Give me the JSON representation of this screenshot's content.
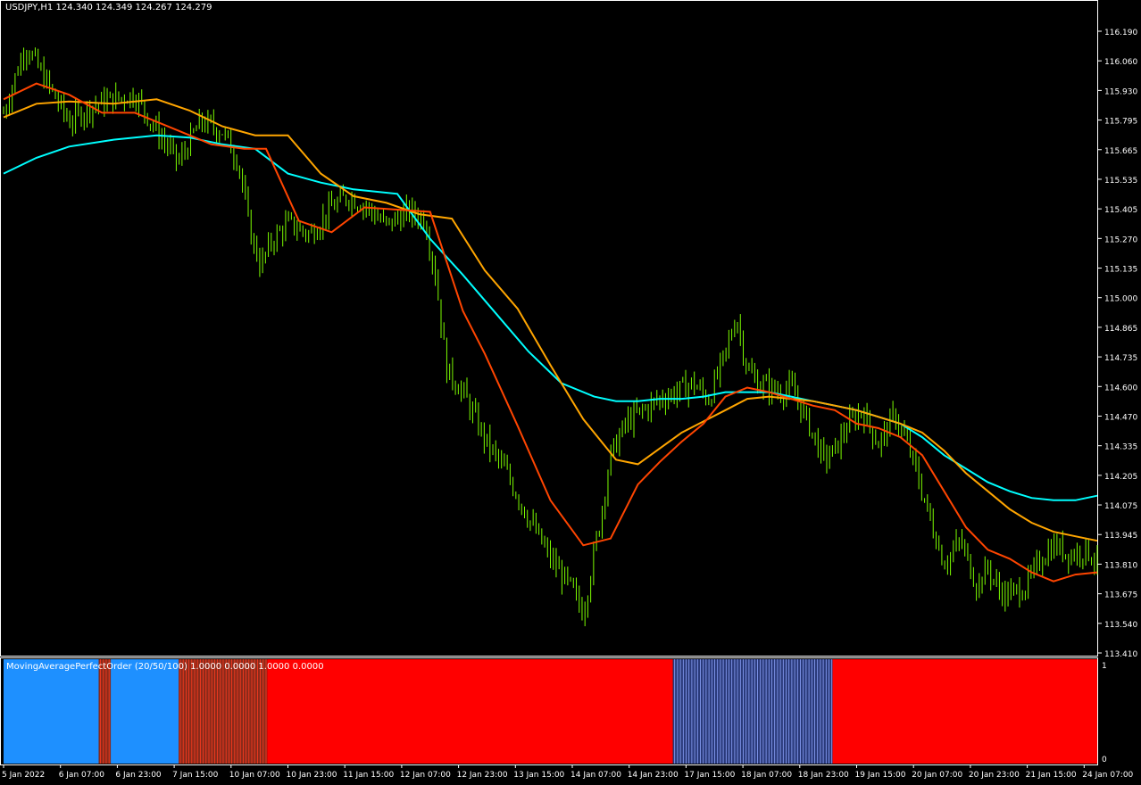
{
  "header": {
    "symbol": "USDJPY,H1",
    "quotes": "124.340 124.349 124.267 124.279"
  },
  "indicator": {
    "label": "MovingAveragePerfectOrder (20/50/100) 1.0000 0.0000 1.0000 0.0000",
    "scale_top": "1",
    "scale_bottom": "0",
    "segments": [
      {
        "from": 0,
        "to": 0.087,
        "state": "bullish",
        "color": "#1e90ff"
      },
      {
        "from": 0.087,
        "to": 0.098,
        "state": "mixed",
        "color": "#8b2a1a"
      },
      {
        "from": 0.098,
        "to": 0.16,
        "state": "bullish",
        "color": "#1e90ff"
      },
      {
        "from": 0.16,
        "to": 0.241,
        "state": "mixed",
        "color": "#8b2a1a"
      },
      {
        "from": 0.241,
        "to": 0.612,
        "state": "bearish",
        "color": "#ff0000"
      },
      {
        "from": 0.612,
        "to": 0.758,
        "state": "mixed",
        "color": "#2a3a7a"
      },
      {
        "from": 0.758,
        "to": 1,
        "state": "bearish",
        "color": "#ff0000"
      }
    ]
  },
  "chart_data": {
    "type": "line",
    "title": "USDJPY,H1",
    "y_ticks": [
      "116.190",
      "116.060",
      "115.930",
      "115.795",
      "115.665",
      "115.535",
      "115.405",
      "115.270",
      "115.135",
      "115.000",
      "114.865",
      "114.735",
      "114.600",
      "114.470",
      "114.335",
      "114.205",
      "114.075",
      "113.945",
      "113.810",
      "113.675",
      "113.540",
      "113.410"
    ],
    "ylim": [
      113.41,
      116.19
    ],
    "x_ticks": [
      "5 Jan 2022",
      "6 Jan 07:00",
      "6 Jan 23:00",
      "7 Jan 15:00",
      "10 Jan 07:00",
      "10 Jan 23:00",
      "11 Jan 15:00",
      "12 Jan 07:00",
      "12 Jan 23:00",
      "13 Jan 15:00",
      "14 Jan 07:00",
      "14 Jan 23:00",
      "17 Jan 15:00",
      "18 Jan 07:00",
      "18 Jan 23:00",
      "19 Jan 15:00",
      "20 Jan 07:00",
      "20 Jan 23:00",
      "21 Jan 15:00",
      "24 Jan 07:00"
    ],
    "x_tick_pos": [
      0,
      0.052,
      0.104,
      0.156,
      0.208,
      0.26,
      0.312,
      0.364,
      0.416,
      0.468,
      0.52,
      0.572,
      0.624,
      0.676,
      0.728,
      0.78,
      0.832,
      0.884,
      0.936,
      0.988
    ],
    "colors": {
      "price": "#7CFC00",
      "ma20": "#ff4500",
      "ma50": "#ffa500",
      "ma100": "#00ffff",
      "bullish": "#1e90ff",
      "bearish": "#ff0000"
    },
    "price": {
      "t": [
        0,
        0.02,
        0.04,
        0.06,
        0.08,
        0.1,
        0.12,
        0.14,
        0.16,
        0.18,
        0.2,
        0.215,
        0.225,
        0.235,
        0.245,
        0.26,
        0.28,
        0.3,
        0.315,
        0.33,
        0.35,
        0.37,
        0.385,
        0.395,
        0.405,
        0.42,
        0.44,
        0.46,
        0.48,
        0.5,
        0.52,
        0.53,
        0.545,
        0.555,
        0.57,
        0.585,
        0.6,
        0.615,
        0.63,
        0.645,
        0.66,
        0.67,
        0.68,
        0.69,
        0.7,
        0.71,
        0.72,
        0.735,
        0.75,
        0.76,
        0.77,
        0.785,
        0.8,
        0.815,
        0.83,
        0.845,
        0.86,
        0.875,
        0.89,
        0.9,
        0.91,
        0.92,
        0.935,
        0.95,
        0.96,
        0.975,
        0.99,
        1
      ],
      "y": [
        115.82,
        116.12,
        115.95,
        115.78,
        115.85,
        115.88,
        115.9,
        115.74,
        115.6,
        115.78,
        115.74,
        115.6,
        115.3,
        115.14,
        115.25,
        115.33,
        115.28,
        115.4,
        115.45,
        115.41,
        115.32,
        115.38,
        115.35,
        115.1,
        114.68,
        114.58,
        114.37,
        114.22,
        114.02,
        113.84,
        113.7,
        113.6,
        114.0,
        114.3,
        114.45,
        114.5,
        114.55,
        114.58,
        114.62,
        114.55,
        114.75,
        114.92,
        114.68,
        114.62,
        114.6,
        114.58,
        114.6,
        114.45,
        114.28,
        114.32,
        114.42,
        114.5,
        114.35,
        114.48,
        114.3,
        114.05,
        113.82,
        113.92,
        113.72,
        113.8,
        113.7,
        113.68,
        113.72,
        113.85,
        113.9,
        113.86,
        113.88,
        113.82
      ]
    },
    "ma20": {
      "t": [
        0,
        0.03,
        0.06,
        0.09,
        0.12,
        0.16,
        0.19,
        0.22,
        0.24,
        0.27,
        0.3,
        0.33,
        0.36,
        0.39,
        0.42,
        0.44,
        0.47,
        0.5,
        0.53,
        0.555,
        0.58,
        0.6,
        0.62,
        0.64,
        0.66,
        0.68,
        0.7,
        0.72,
        0.74,
        0.76,
        0.78,
        0.8,
        0.82,
        0.84,
        0.86,
        0.88,
        0.9,
        0.92,
        0.94,
        0.96,
        0.98,
        1
      ],
      "y": [
        115.88,
        115.95,
        115.9,
        115.82,
        115.82,
        115.74,
        115.68,
        115.66,
        115.66,
        115.34,
        115.29,
        115.4,
        115.39,
        115.38,
        114.94,
        114.75,
        114.43,
        114.1,
        113.9,
        113.93,
        114.17,
        114.27,
        114.36,
        114.44,
        114.56,
        114.6,
        114.58,
        114.55,
        114.52,
        114.5,
        114.44,
        114.42,
        114.38,
        114.3,
        114.14,
        113.98,
        113.88,
        113.84,
        113.78,
        113.74,
        113.77,
        113.78
      ]
    },
    "ma50": {
      "t": [
        0,
        0.03,
        0.06,
        0.1,
        0.14,
        0.17,
        0.2,
        0.23,
        0.26,
        0.29,
        0.32,
        0.35,
        0.38,
        0.41,
        0.44,
        0.47,
        0.5,
        0.53,
        0.56,
        0.58,
        0.6,
        0.62,
        0.64,
        0.66,
        0.68,
        0.7,
        0.72,
        0.74,
        0.76,
        0.78,
        0.8,
        0.82,
        0.84,
        0.86,
        0.88,
        0.9,
        0.92,
        0.94,
        0.96,
        0.98,
        1
      ],
      "y": [
        115.8,
        115.86,
        115.87,
        115.86,
        115.88,
        115.83,
        115.76,
        115.72,
        115.72,
        115.55,
        115.45,
        115.42,
        115.37,
        115.35,
        115.12,
        114.95,
        114.7,
        114.46,
        114.28,
        114.26,
        114.33,
        114.4,
        114.45,
        114.5,
        114.55,
        114.56,
        114.55,
        114.54,
        114.52,
        114.5,
        114.47,
        114.44,
        114.4,
        114.32,
        114.22,
        114.14,
        114.06,
        114.0,
        113.96,
        113.94,
        113.92
      ]
    },
    "ma100": {
      "t": [
        0,
        0.03,
        0.06,
        0.1,
        0.14,
        0.17,
        0.2,
        0.23,
        0.26,
        0.29,
        0.32,
        0.36,
        0.39,
        0.42,
        0.45,
        0.48,
        0.51,
        0.54,
        0.56,
        0.58,
        0.6,
        0.62,
        0.64,
        0.66,
        0.68,
        0.7,
        0.72,
        0.74,
        0.76,
        0.78,
        0.8,
        0.82,
        0.84,
        0.86,
        0.88,
        0.9,
        0.92,
        0.94,
        0.96,
        0.98,
        1
      ],
      "y": [
        115.55,
        115.62,
        115.67,
        115.7,
        115.72,
        115.71,
        115.68,
        115.66,
        115.55,
        115.51,
        115.48,
        115.46,
        115.26,
        115.1,
        114.93,
        114.76,
        114.62,
        114.56,
        114.54,
        114.54,
        114.55,
        114.55,
        114.56,
        114.58,
        114.58,
        114.58,
        114.56,
        114.54,
        114.52,
        114.5,
        114.47,
        114.44,
        114.38,
        114.3,
        114.24,
        114.18,
        114.14,
        114.11,
        114.1,
        114.1,
        114.12
      ]
    }
  }
}
